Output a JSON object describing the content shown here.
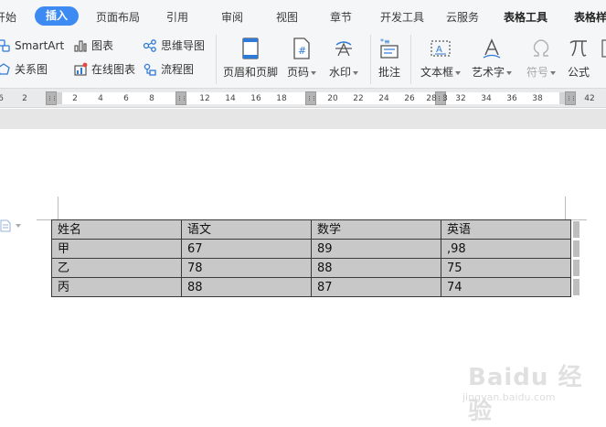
{
  "menu": {
    "tabs": [
      "开始",
      "插入",
      "页面布局",
      "引用",
      "审阅",
      "视图",
      "章节",
      "开发工具",
      "云服务",
      "表格工具",
      "表格样式"
    ],
    "active_tab": "插入"
  },
  "ribbon": {
    "smartart": "SmartArt",
    "relation_chart": "关系图",
    "chart": "图表",
    "online_chart": "在线图表",
    "mind_map": "思维导图",
    "flowchart": "流程图",
    "header_footer": "页眉和页脚",
    "page_number": "页码",
    "watermark": "水印",
    "comment": "批注",
    "text_box": "文本框",
    "word_art": "艺术字",
    "symbol": "符号",
    "formula": "公式"
  },
  "ruler": {
    "labels": [
      "6",
      "2",
      "2",
      "4",
      "6",
      "8",
      "12",
      "14",
      "16",
      "18",
      "20",
      "22",
      "24",
      "26",
      "28",
      "3",
      "32",
      "34",
      "36",
      "38",
      "42"
    ]
  },
  "table": {
    "headers": [
      "姓名",
      "语文",
      "数学",
      "英语"
    ],
    "rows": [
      [
        "甲",
        "67",
        "89",
        ",98"
      ],
      [
        "乙",
        "78",
        "88",
        "75"
      ],
      [
        "丙",
        "88",
        "87",
        "74"
      ]
    ]
  },
  "watermark": {
    "brand": "Baidu 经验",
    "url": "jingyan.baidu.com"
  },
  "colors": {
    "accent": "#3d8bf2",
    "ribbon_bg": "#f5f6f7",
    "table_fill": "#c8c8c8"
  }
}
